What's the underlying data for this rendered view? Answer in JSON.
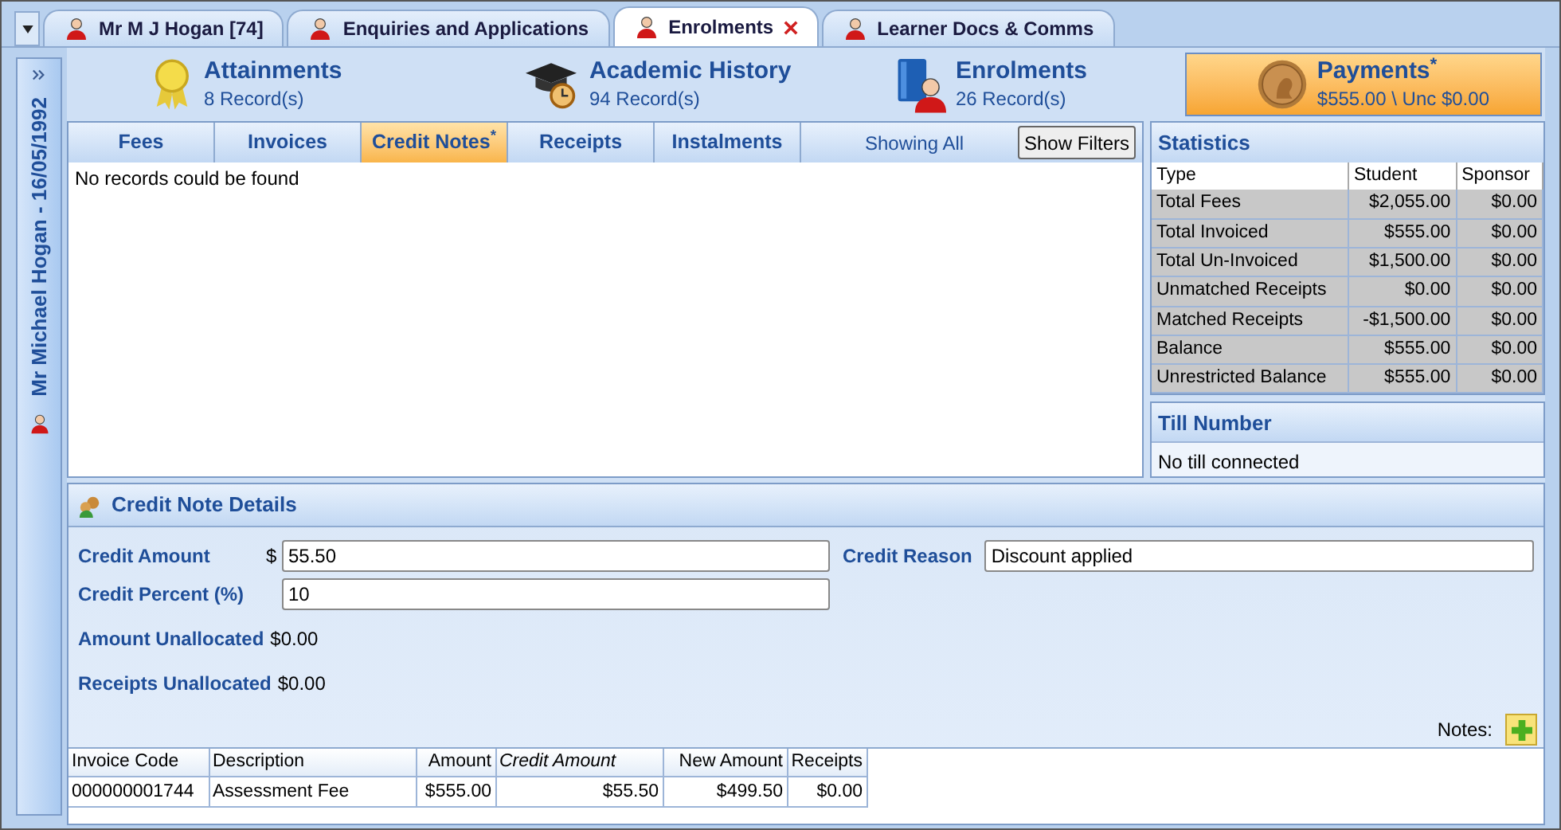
{
  "doc_tabs": [
    {
      "label": "Mr M J Hogan [74]",
      "selected": false,
      "closable": false
    },
    {
      "label": "Enquiries and Applications",
      "selected": false,
      "closable": false
    },
    {
      "label": "Enrolments",
      "selected": true,
      "closable": true
    },
    {
      "label": "Learner Docs & Comms",
      "selected": false,
      "closable": false
    }
  ],
  "side_strip": {
    "label": "Mr Michael Hogan - 16/05/1992"
  },
  "tiles": [
    {
      "kind": "attainments",
      "title": "Attainments",
      "subtitle": "8 Record(s)",
      "selected": false
    },
    {
      "kind": "history",
      "title": "Academic History",
      "subtitle": "94 Record(s)",
      "selected": false
    },
    {
      "kind": "enrolments",
      "title": "Enrolments",
      "subtitle": "26 Record(s)",
      "selected": false
    },
    {
      "kind": "payments",
      "title": "Payments$^{*}$",
      "subtitle": "$555.00 \\ Unc $0.00",
      "selected": true
    }
  ],
  "sub_tabs": [
    {
      "label": "Fees",
      "selected": false
    },
    {
      "label": "Invoices",
      "selected": false
    },
    {
      "label": "Credit Notes$^{*}$",
      "selected": true
    },
    {
      "label": "Receipts",
      "selected": false
    },
    {
      "label": "Instalments",
      "selected": false
    }
  ],
  "filter_status": "Showing All",
  "filter_button": "Show Filters",
  "empty_message": "No records could be found",
  "statistics": {
    "title": "Statistics",
    "columns": [
      "Type",
      "Student",
      "Sponsor"
    ],
    "rows": [
      [
        "Total Fees",
        "$2,055.00",
        "$0.00"
      ],
      [
        "Total Invoiced",
        "$555.00",
        "$0.00"
      ],
      [
        "Total Un-Invoiced",
        "$1,500.00",
        "$0.00"
      ],
      [
        "Unmatched Receipts",
        "$0.00",
        "$0.00"
      ],
      [
        "Matched Receipts",
        "-$1,500.00",
        "$0.00"
      ],
      [
        "Balance",
        "$555.00",
        "$0.00"
      ],
      [
        "Unrestricted Balance",
        "$555.00",
        "$0.00"
      ]
    ]
  },
  "till": {
    "title": "Till Number",
    "text": "No till connected"
  },
  "details": {
    "title": "Credit Note Details",
    "credit_amount_label": "Credit Amount",
    "currency": "$",
    "credit_amount": "55.50",
    "credit_reason_label": "Credit Reason",
    "credit_reason": "Discount applied",
    "credit_percent_label": "Credit Percent (%)",
    "credit_percent": "10",
    "amount_unallocated_label": "Amount Unallocated",
    "amount_unallocated": "$0.00",
    "receipts_unallocated_label": "Receipts Unallocated",
    "receipts_unallocated": "$0.00",
    "notes_label": "Notes:"
  },
  "invoice_table": {
    "columns": [
      {
        "label": "Invoice Code",
        "italic": false
      },
      {
        "label": "Description",
        "italic": false
      },
      {
        "label": "Amount",
        "italic": false
      },
      {
        "label": "Credit Amount",
        "italic": true
      },
      {
        "label": "New Amount",
        "italic": false
      },
      {
        "label": "Receipts",
        "italic": false
      }
    ],
    "rows": [
      [
        "000000001744",
        "Assessment Fee",
        "$555.00",
        "$55.50",
        "$499.50",
        "$0.00"
      ]
    ]
  }
}
